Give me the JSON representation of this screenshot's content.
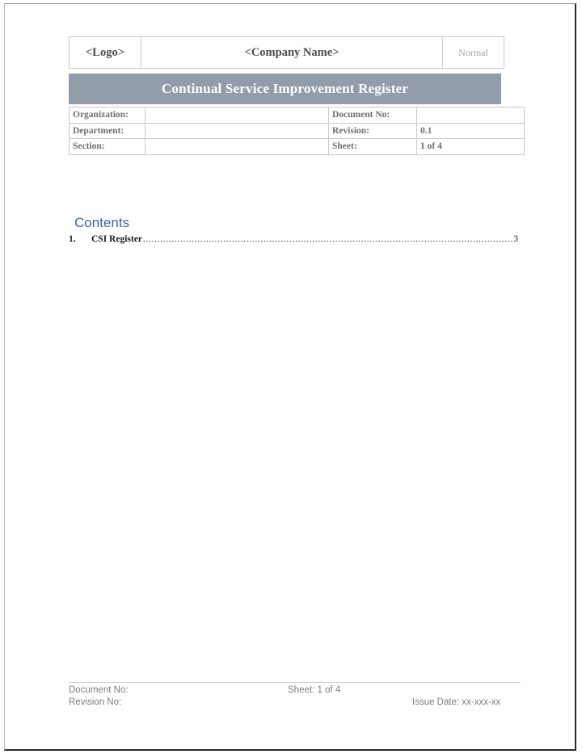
{
  "document": {
    "header": {
      "logo_placeholder": "<Logo>",
      "company_placeholder": "<Company Name>",
      "classification": "Normal"
    },
    "title": "Continual Service Improvement Register",
    "info_table": {
      "rows": [
        {
          "label_left": "Organization:",
          "value_left": "",
          "label_right": "Document No:",
          "value_right": ""
        },
        {
          "label_left": "Department:",
          "value_left": "",
          "label_right": "Revision:",
          "value_right": "0.1"
        },
        {
          "label_left": "Section:",
          "value_left": "",
          "label_right": "Sheet:",
          "value_right": "1 of 4"
        }
      ]
    },
    "contents": {
      "heading": "Contents",
      "entries": [
        {
          "number": "1.",
          "title": "CSI Register",
          "leader": "............................................................................................................................................",
          "page": "3"
        }
      ]
    },
    "footer": {
      "document_no": "Document No:",
      "sheet": "Sheet: 1 of 4",
      "revision_no": "Revision No:",
      "issue_date": "Issue Date: xx-xxx-xx"
    },
    "colors": {
      "banner": "#929CAB",
      "heading_blue": "#3F62A8",
      "table_border": "#C9C9C9",
      "label_gray": "#6F6F6F",
      "footer_gray": "#7D7D7D"
    }
  }
}
